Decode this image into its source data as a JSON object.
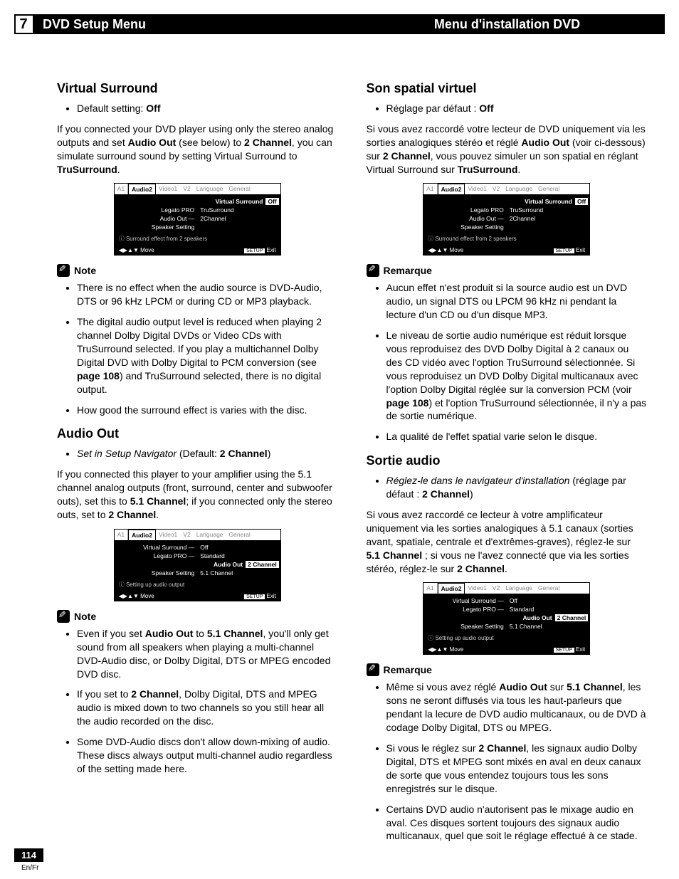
{
  "header": {
    "num": "7",
    "left": "DVD Setup Menu",
    "right": "Menu d'installation DVD"
  },
  "footer": {
    "page": "114",
    "lang": "En/Fr"
  },
  "osd": {
    "tabs": {
      "a1": "A1",
      "a2": "Audio2",
      "v1": "Video1",
      "v2": "V2",
      "lang": "Language",
      "gen": "General"
    },
    "foot_move": "Move",
    "foot_setup": "SETUP",
    "foot_exit": "Exit",
    "vs": {
      "r1l": "Virtual Surround",
      "r1r": "Off",
      "r2l": "Legato PRO",
      "r2r": "TruSurround",
      "r3l": "Audio Out —",
      "r3r": "2Channel",
      "r4l": "Speaker Setting",
      "r4r": "",
      "hint": "ⓘ Surround effect from 2 speakers"
    },
    "ao": {
      "r1l": "Virtual Surround —",
      "r1r": "Off",
      "r2l": "Legato PRO —",
      "r2r": "Standard",
      "r3l": "Audio Out",
      "r3r": "2 Channel",
      "r4l": "Speaker Setting",
      "r4r": "5.1 Channel",
      "hint": "ⓘ Setting up audio output"
    }
  },
  "en": {
    "s1_h": "Virtual Surround",
    "s1_b1_a": "Default setting: ",
    "s1_b1_b": "Off",
    "s1_p_a": "If you connected your DVD player using only the stereo analog outputs and set ",
    "s1_p_b": "Audio Out",
    "s1_p_c": " (see below) to ",
    "s1_p_d": "2 Channel",
    "s1_p_e": ", you can simulate surround sound by setting Virtual Surround to ",
    "s1_p_f": "TruSurround",
    "s1_p_g": ".",
    "note": "Note",
    "s1_n1": "There is no effect when the audio source is DVD-Audio, DTS or 96 kHz LPCM or during CD or MP3 playback.",
    "s1_n2_a": "The digital audio output level is reduced when playing 2 channel Dolby Digital DVDs or Video CDs with TruSurround selected. If you play a multichannel Dolby Digital DVD with Dolby Digital to PCM conversion (see ",
    "s1_n2_b": "page 108",
    "s1_n2_c": ") and TruSurround selected, there is no digital output.",
    "s1_n3": "How good the surround effect is varies with the disc.",
    "s2_h": "Audio Out",
    "s2_b1_a": "Set in Setup Navigator",
    "s2_b1_b": " (Default: ",
    "s2_b1_c": "2 Channel",
    "s2_b1_d": ")",
    "s2_p_a": "If you connected this player to your amplifier using the 5.1 channel analog outputs (front, surround, center and subwoofer outs), set this to ",
    "s2_p_b": "5.1 Channel",
    "s2_p_c": "; if you connected only the stereo outs, set to ",
    "s2_p_d": "2 Channel",
    "s2_p_e": ".",
    "s2_n1_a": "Even if you set ",
    "s2_n1_b": "Audio Out",
    "s2_n1_c": " to ",
    "s2_n1_d": "5.1 Channel",
    "s2_n1_e": ", you'll only get sound from all speakers when playing a multi-channel DVD-Audio disc, or Dolby Digital, DTS or MPEG encoded DVD disc.",
    "s2_n2_a": "If you set to ",
    "s2_n2_b": "2 Channel",
    "s2_n2_c": ", Dolby Digital, DTS and MPEG audio is mixed down to two channels so you still hear all the audio recorded on the disc.",
    "s2_n3": "Some DVD-Audio discs don't allow down-mixing of audio. These discs always output multi-channel audio regardless of the setting made here."
  },
  "fr": {
    "s1_h": "Son spatial virtuel",
    "s1_b1_a": "Réglage par défaut : ",
    "s1_b1_b": "Off",
    "s1_p_a": "Si vous avez raccordé votre lecteur de DVD uniquement via les sorties analogiques stéréo et réglé ",
    "s1_p_b": "Audio Out",
    "s1_p_c": " (voir ci-dessous) sur ",
    "s1_p_d": "2 Channel",
    "s1_p_e": ", vous pouvez simuler un son spatial en réglant Virtual Surround sur ",
    "s1_p_f": "TruSurround",
    "s1_p_g": ".",
    "note": "Remarque",
    "s1_n1": "Aucun effet n'est produit si la source audio est un DVD audio, un signal DTS ou LPCM 96 kHz ni pendant la lecture d'un CD ou d'un disque MP3.",
    "s1_n2_a": "Le niveau de sortie audio numérique est réduit lorsque vous reproduisez des DVD Dolby Digital à 2 canaux ou des CD vidéo avec l'option TruSurround sélectionnée. Si vous reproduisez un DVD Dolby Digital multicanaux avec l'option Dolby Digital réglée sur la conversion PCM (voir ",
    "s1_n2_b": "page 108",
    "s1_n2_c": ") et l'option TruSurround sélectionnée, il n'y a pas de sortie numérique.",
    "s1_n3": "La qualité de l'effet spatial varie selon le disque.",
    "s2_h": "Sortie audio",
    "s2_b1_a": "Réglez-le dans le navigateur d'installation",
    "s2_b1_b": " (réglage par défaut : ",
    "s2_b1_c": "2 Channel",
    "s2_b1_d": ")",
    "s2_p_a": "Si vous avez raccordé ce lecteur à votre amplificateur uniquement via les sorties analogiques à 5.1 canaux (sorties avant, spatiale, centrale et d'extrêmes-graves), réglez-le sur ",
    "s2_p_b": "5.1 Channel",
    "s2_p_c": " ; si vous ne l'avez connecté que via les sorties stéréo, réglez-le sur ",
    "s2_p_d": "2 Channel",
    "s2_p_e": ".",
    "s2_n1_a": "Même si vous avez réglé ",
    "s2_n1_b": "Audio Out",
    "s2_n1_c": " sur ",
    "s2_n1_d": "5.1 Channel",
    "s2_n1_e": ", les sons ne seront diffusés via tous les haut-parleurs que pendant la lecure de DVD audio multicanaux, ou de DVD à codage Dolby Digital, DTS ou MPEG.",
    "s2_n2_a": "Si vous le réglez sur ",
    "s2_n2_b": "2 Channel",
    "s2_n2_c": ", les signaux audio Dolby Digital, DTS et MPEG sont mixés en aval en deux canaux de sorte que vous entendez toujours tous les sons enregistrés sur le disque.",
    "s2_n3": "Certains DVD audio n'autorisent pas le mixage audio en aval. Ces disques sortent toujours des signaux audio multicanaux, quel que soit le réglage effectué à ce stade."
  }
}
